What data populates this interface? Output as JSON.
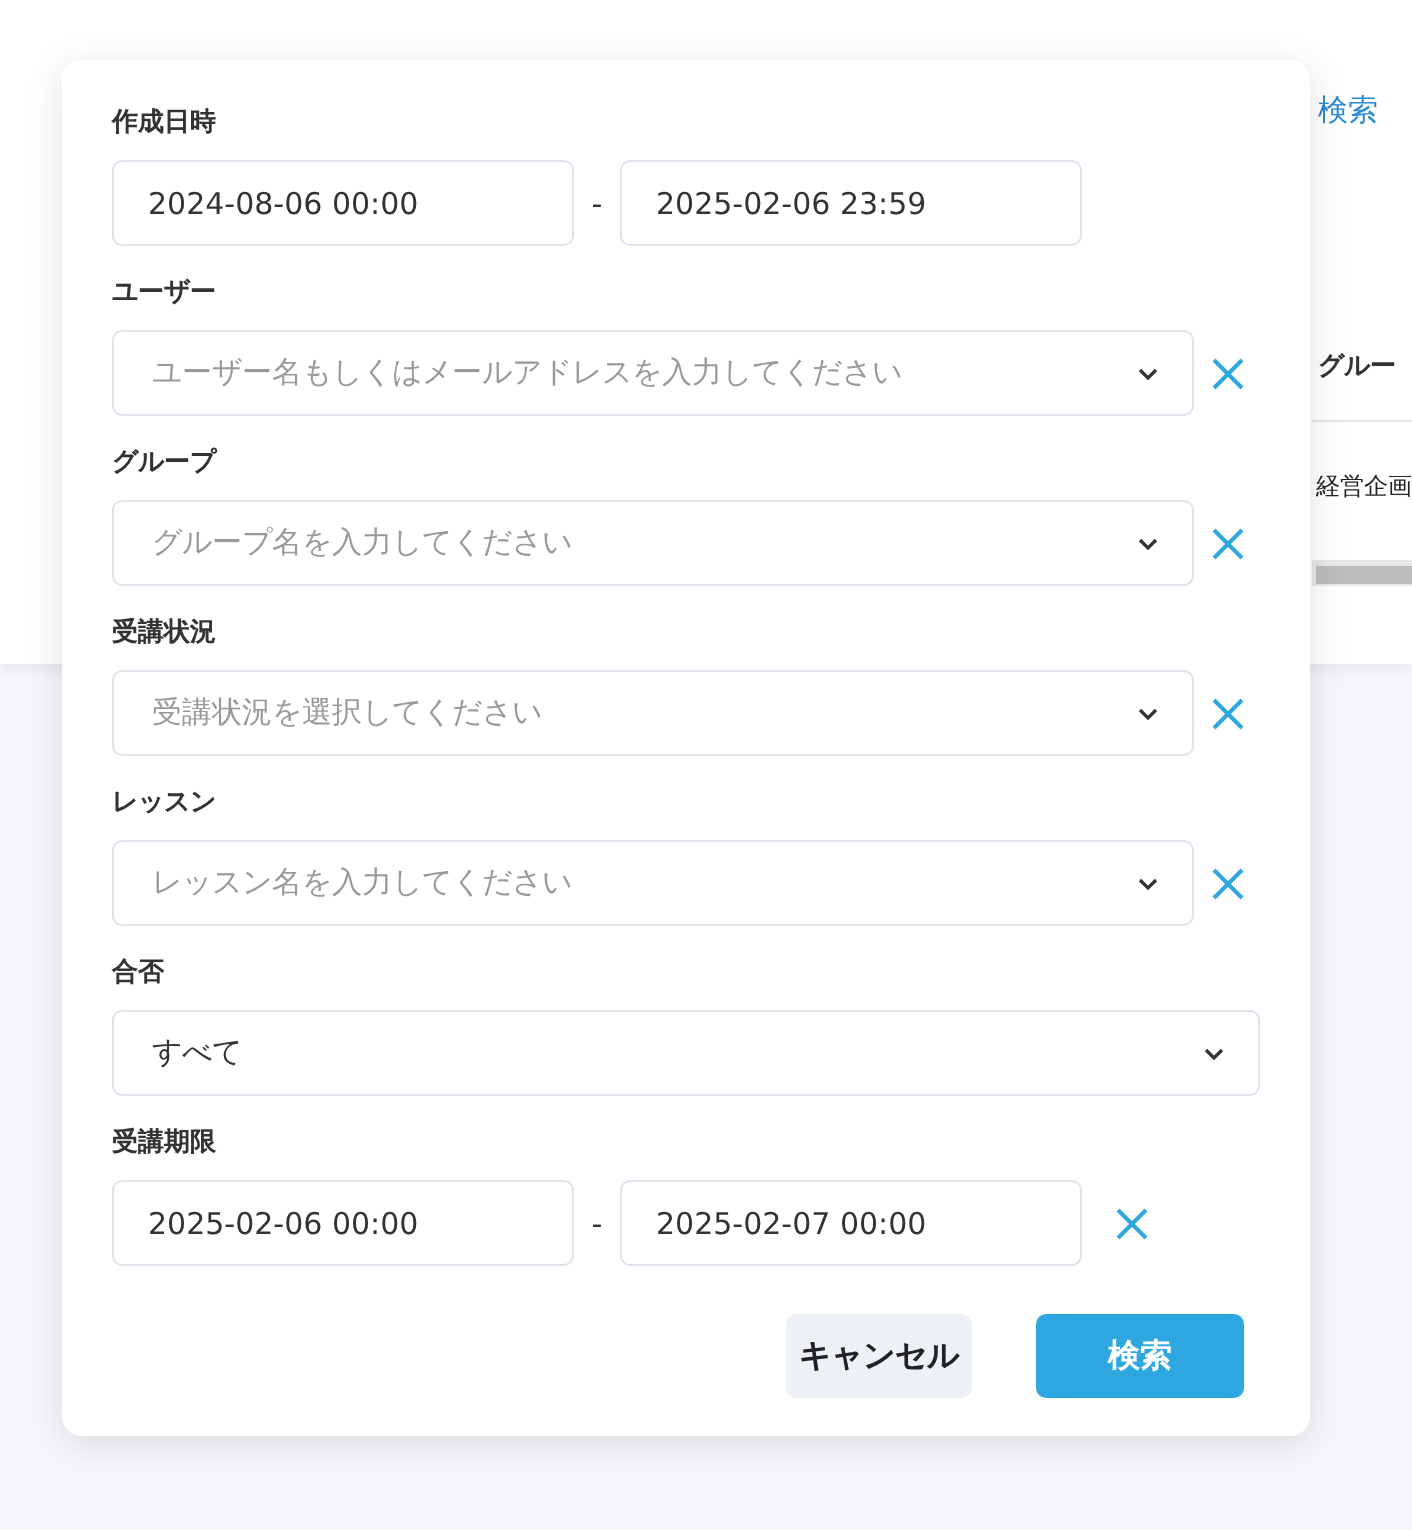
{
  "background": {
    "link": "検索",
    "column_header": "グルー",
    "cell": "経営企画"
  },
  "dialog": {
    "fields": [
      {
        "kind": "range",
        "label": "作成日時",
        "from": "2024-08-06 00:00",
        "separator": "-",
        "to": "2025-02-06 23:59",
        "clearable": false
      },
      {
        "kind": "select",
        "label": "ユーザー",
        "placeholder": "ユーザー名もしくはメールアドレスを入力してください",
        "clearable": true
      },
      {
        "kind": "select",
        "label": "グループ",
        "placeholder": "グループ名を入力してください",
        "clearable": true
      },
      {
        "kind": "select",
        "label": "受講状況",
        "placeholder": "受講状況を選択してください",
        "clearable": true
      },
      {
        "kind": "select",
        "label": "レッスン",
        "placeholder": "レッスン名を入力してください",
        "clearable": true
      },
      {
        "kind": "select",
        "label": "合否",
        "value": "すべて",
        "clearable": false
      },
      {
        "kind": "range",
        "label": "受講期限",
        "from": "2025-02-06 00:00",
        "separator": "-",
        "to": "2025-02-07 00:00",
        "clearable": true
      }
    ],
    "buttons": [
      {
        "kind": "secondary",
        "label": "キャンセル"
      },
      {
        "kind": "primary",
        "label": "検索"
      }
    ]
  }
}
